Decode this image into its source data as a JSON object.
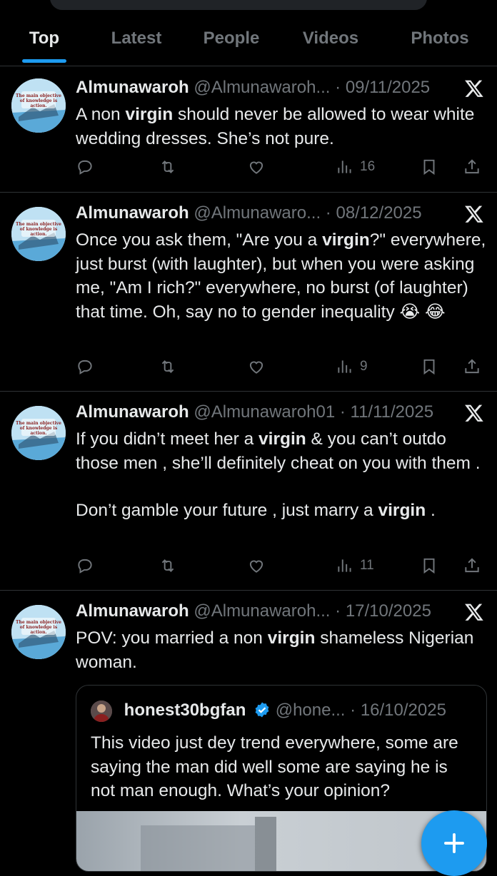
{
  "tabs": [
    {
      "label": "Top"
    },
    {
      "label": "Latest"
    },
    {
      "label": "People"
    },
    {
      "label": "Videos"
    },
    {
      "label": "Photos"
    }
  ],
  "highlight_color": "#1d9bf0",
  "posts": [
    {
      "name": "Almunawaroh",
      "handle": "@Almunawaroh...",
      "sep": "·",
      "date": "09/11/2025",
      "text": [
        "A non ",
        "virgin",
        " should never be allowed to wear white wedding dresses. She’s not pure."
      ],
      "views": "16",
      "avatar_text": "“The main objective of knowledge is action.”"
    },
    {
      "name": "Almunawaroh",
      "handle": "@Almunawaro...",
      "sep": "·",
      "date": "08/12/2025",
      "text": [
        "Once you ask them, \"Are you a ",
        "virgin",
        "?\" everywhere, just burst (with laughter), but when you were asking me, \"Am I rich?\" everywhere, no burst (of laughter) that time. Oh, say no to gender inequality 😭 😂"
      ],
      "views": "9"
    },
    {
      "name": "Almunawaroh",
      "handle": "@Almunawaroh01",
      "sep": "·",
      "date": "11/11/2025",
      "text1": [
        "If you didn’t meet her a ",
        "virgin",
        " & you can’t outdo those men , she’ll definitely cheat on you with them ."
      ],
      "text2": [
        "Don’t gamble your future , just marry a ",
        "virgin",
        " ."
      ],
      "views": "11"
    },
    {
      "name": "Almunawaroh",
      "handle": "@Almunawaroh...",
      "sep": "·",
      "date": "17/10/2025",
      "text": [
        "POV: you married a non ",
        "virgin",
        " shameless Nigerian woman."
      ],
      "quote": {
        "name": "honest30bgfan",
        "handle": "@hone...",
        "sep": "·",
        "date": "16/10/2025",
        "text": "This video just dey trend everywhere, some are saying the man did well some are saying he is not man enough. What’s your opinion?"
      }
    }
  ],
  "icons": {
    "reply": "reply-icon",
    "repost": "repost-icon",
    "like": "like-icon",
    "views": "views-icon",
    "bookmark": "bookmark-icon",
    "share": "share-icon",
    "x": "x-logo-icon",
    "compose": "compose-plus-icon"
  }
}
